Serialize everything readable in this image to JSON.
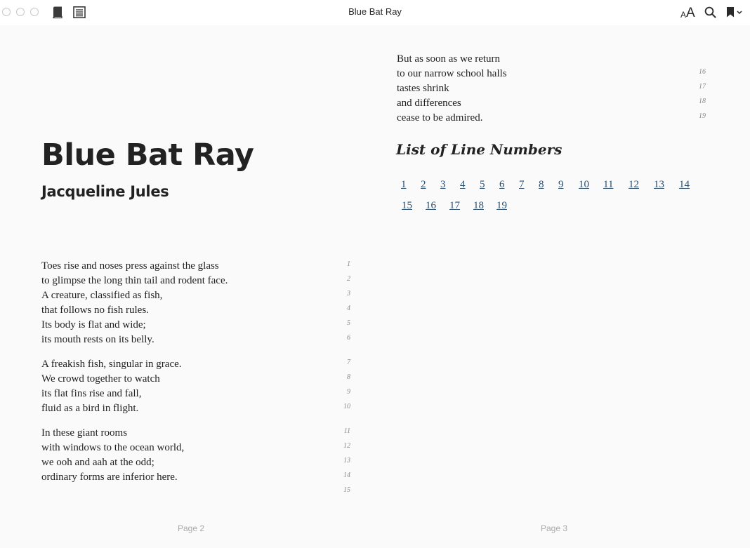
{
  "window": {
    "title": "Blue Bat Ray",
    "font_small_a": "A",
    "font_big_a": "A"
  },
  "toolbar_icons": [
    "close-icon",
    "minimize-icon",
    "zoom-icon",
    "library-icon",
    "table-of-contents-icon",
    "font-size-icon",
    "search-icon",
    "bookmark-icon",
    "chevron-down-icon"
  ],
  "book": {
    "title": "Blue Bat Ray",
    "author": "Jacqueline Jules"
  },
  "poem_page_2": [
    {
      "text": "Toes rise and noses press against the glass",
      "num": "1"
    },
    {
      "text": "to glimpse the long thin tail and rodent face.",
      "num": "2"
    },
    {
      "text": "A creature, classified as fish,",
      "num": "3"
    },
    {
      "text": "that follows no fish rules.",
      "num": "4"
    },
    {
      "text": "Its body is flat and wide;",
      "num": "5"
    },
    {
      "text": "its mouth rests on its belly.",
      "num": "6"
    },
    {
      "text": "A freakish fish, singular in grace.",
      "num": "7"
    },
    {
      "text": "We crowd together to watch",
      "num": "8"
    },
    {
      "text": "its flat fins rise and fall,",
      "num": "9"
    },
    {
      "text": "fluid as a bird in flight.",
      "num": "10"
    },
    {
      "text": "In these giant rooms",
      "num": "11"
    },
    {
      "text": "with windows to the ocean world,",
      "num": "12"
    },
    {
      "text": "we ooh and aah at the odd;",
      "num": "13"
    },
    {
      "text": "ordinary forms are inferior here.",
      "num": "14"
    },
    {
      "text": "",
      "num": "15"
    }
  ],
  "poem_page_3": [
    {
      "text": "But as soon as we return",
      "num": ""
    },
    {
      "text": "to our narrow school halls",
      "num": "16"
    },
    {
      "text": "tastes shrink",
      "num": "17"
    },
    {
      "text": "and differences",
      "num": "18"
    },
    {
      "text": "cease to be admired.",
      "num": "19"
    }
  ],
  "line_numbers_section": {
    "heading": "List of Line Numbers",
    "links": [
      "1",
      "2",
      "3",
      "4",
      "5",
      "6",
      "7",
      "8",
      "9",
      "10",
      "11",
      "12",
      "13",
      "14",
      "15",
      "16",
      "17",
      "18",
      "19"
    ]
  },
  "pages": {
    "left": "Page 2",
    "right": "Page 3"
  },
  "colors": {
    "page_background": "#fafafa",
    "link": "#2b4e6f",
    "line_number": "#8a8a8a",
    "page_number": "#a9a9a9"
  }
}
